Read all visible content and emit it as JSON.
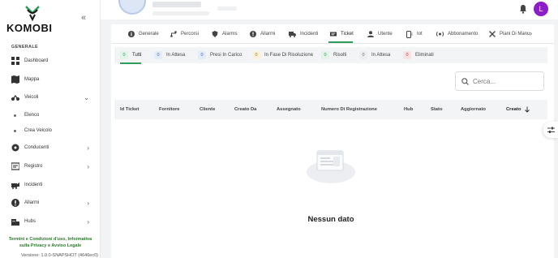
{
  "brand": {
    "name": "KOMOBI",
    "accent": "#2e9d5a",
    "avatar_color": "#8c1ec9"
  },
  "sidebar": {
    "section_label": "GENERALE",
    "items": [
      {
        "label": "Dashboard",
        "icon": "dashboard-icon"
      },
      {
        "label": "Mappa",
        "icon": "map-icon"
      },
      {
        "label": "Veicoli",
        "icon": "motorbike-icon",
        "expanded": true
      },
      {
        "label": "Conducenti",
        "icon": "driver-icon"
      },
      {
        "label": "Registro",
        "icon": "register-icon"
      },
      {
        "label": "Incidenti",
        "icon": "crash-icon"
      },
      {
        "label": "Allarmi",
        "icon": "alarm-icon"
      },
      {
        "label": "Hubs",
        "icon": "hubs-icon"
      }
    ],
    "sub_items": [
      {
        "label": "Elenco"
      },
      {
        "label": "Crea Veicolo"
      }
    ],
    "footer_links": "Termini e Condizioni d'uso, Informativa sulla Privacy e Avviso Legale",
    "version": "Versione: 1.0.0-SNAPSHOT (4646ec0)"
  },
  "header": {
    "user_initial": "L"
  },
  "tabs": [
    {
      "label": "Generale",
      "icon": "info-icon"
    },
    {
      "label": "Percorsi",
      "icon": "route-icon"
    },
    {
      "label": "Alarms",
      "icon": "shield-icon"
    },
    {
      "label": "Allarmi",
      "icon": "alert-icon"
    },
    {
      "label": "Incidenti",
      "icon": "truck-icon"
    },
    {
      "label": "Ticket",
      "icon": "ticket-icon",
      "active": true
    },
    {
      "label": "Utente",
      "icon": "user-icon"
    },
    {
      "label": "Iot",
      "icon": "iot-icon"
    },
    {
      "label": "Abbonamento",
      "icon": "subscription-icon"
    },
    {
      "label": "Piani Di Manu",
      "icon": "tools-icon"
    }
  ],
  "filters": [
    {
      "count": "0",
      "label": "Tutti",
      "badge_bg": "#e3f3e8",
      "badge_fg": "#2e9d5a"
    },
    {
      "count": "0",
      "label": "In Attesa",
      "badge_bg": "#e3ecf8",
      "badge_fg": "#3466b0"
    },
    {
      "count": "0",
      "label": "Presi In Carico",
      "badge_bg": "#e3ecf8",
      "badge_fg": "#3466b0"
    },
    {
      "count": "0",
      "label": "In Fase Di Risoluzione",
      "badge_bg": "#fbf1dc",
      "badge_fg": "#b07a10"
    },
    {
      "count": "0",
      "label": "Risolti",
      "badge_bg": "#e3f3e8",
      "badge_fg": "#2e9d5a"
    },
    {
      "count": "0",
      "label": "In Attesa",
      "badge_bg": "#eceef0",
      "badge_fg": "#666666"
    },
    {
      "count": "0",
      "label": "Eliminati",
      "badge_bg": "#fbe3e3",
      "badge_fg": "#c03a3a"
    }
  ],
  "search": {
    "placeholder": "Cerca..."
  },
  "table": {
    "columns": [
      "Id Ticket",
      "Fornitore",
      "Cliente",
      "Creato Da",
      "Assegnato",
      "Numero Di Registrazione",
      "Hub",
      "Stato",
      "Aggiornato",
      "Creato"
    ],
    "sort_column": "Creato",
    "empty_text": "Nessun dato"
  }
}
